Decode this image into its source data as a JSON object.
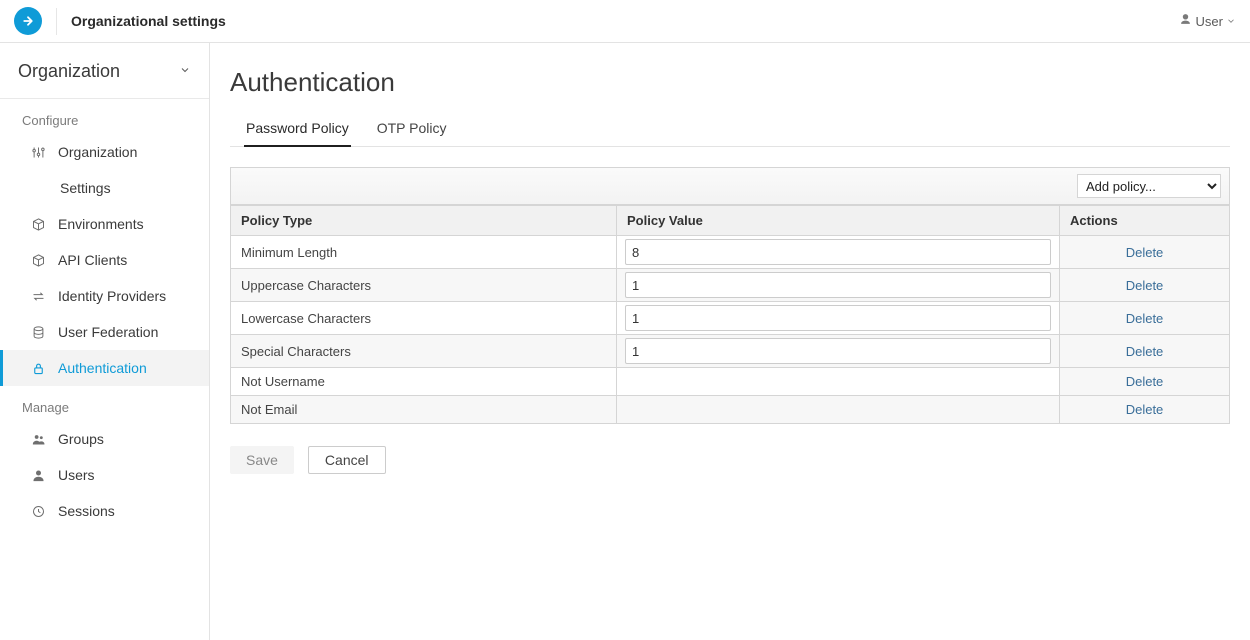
{
  "header": {
    "title": "Organizational settings",
    "user_label": "User"
  },
  "sidebar": {
    "org_title": "Organization",
    "sections": {
      "configure": {
        "label": "Configure",
        "items": [
          {
            "id": "organization",
            "label": "Organization"
          },
          {
            "id": "settings",
            "label": "Settings",
            "indent": true
          },
          {
            "id": "environments",
            "label": "Environments"
          },
          {
            "id": "api-clients",
            "label": "API Clients"
          },
          {
            "id": "identity-providers",
            "label": "Identity Providers"
          },
          {
            "id": "user-federation",
            "label": "User Federation"
          },
          {
            "id": "authentication",
            "label": "Authentication",
            "active": true
          }
        ]
      },
      "manage": {
        "label": "Manage",
        "items": [
          {
            "id": "groups",
            "label": "Groups"
          },
          {
            "id": "users",
            "label": "Users"
          },
          {
            "id": "sessions",
            "label": "Sessions"
          }
        ]
      }
    }
  },
  "main": {
    "title": "Authentication",
    "tabs": [
      {
        "id": "password-policy",
        "label": "Password Policy",
        "active": true
      },
      {
        "id": "otp-policy",
        "label": "OTP Policy"
      }
    ],
    "add_policy_placeholder": "Add policy...",
    "columns": {
      "type": "Policy Type",
      "value": "Policy Value",
      "actions": "Actions"
    },
    "delete_label": "Delete",
    "rows": [
      {
        "type": "Minimum Length",
        "value": "8"
      },
      {
        "type": "Uppercase Characters",
        "value": "1"
      },
      {
        "type": "Lowercase Characters",
        "value": "1"
      },
      {
        "type": "Special Characters",
        "value": "1"
      },
      {
        "type": "Not Username",
        "value": null
      },
      {
        "type": "Not Email",
        "value": null
      }
    ],
    "buttons": {
      "save": "Save",
      "cancel": "Cancel"
    }
  }
}
